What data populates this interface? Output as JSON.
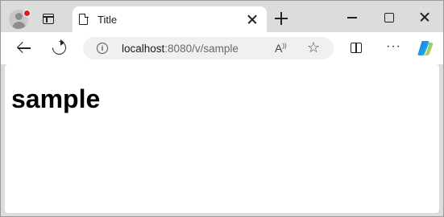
{
  "tab": {
    "title": "Title"
  },
  "address_bar": {
    "url_host": "localhost",
    "url_rest": ":8080/v/sample"
  },
  "toolbar": {
    "read_aloud_label": "A"
  },
  "page": {
    "heading": "sample"
  },
  "colors": {
    "notification_dot": "#e01b1b",
    "chrome_background": "#dcdcdc",
    "omnibox_background": "#eef0f2"
  },
  "icons": [
    "profile-icon",
    "tab-actions-icon",
    "page-icon",
    "close-icon",
    "plus-icon",
    "minimize-icon",
    "maximize-icon",
    "back-arrow-icon",
    "refresh-icon",
    "info-icon",
    "read-aloud-icon",
    "star-icon",
    "split-screen-icon",
    "more-icon",
    "copilot-icon"
  ]
}
